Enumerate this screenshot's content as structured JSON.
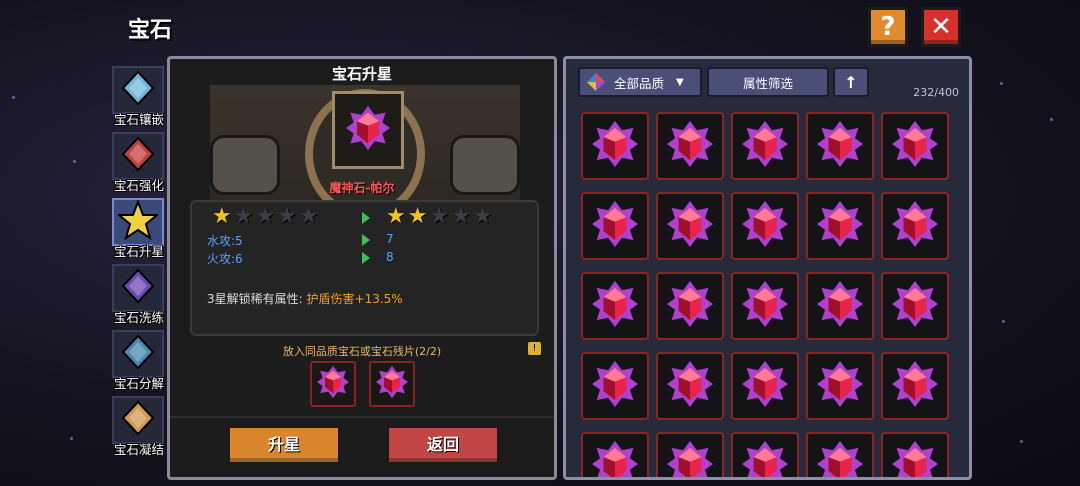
{
  "header": {
    "title": "宝石"
  },
  "buttons": {
    "help": "?",
    "close": "✕"
  },
  "sidebar": {
    "items": [
      {
        "label": "宝石镶嵌",
        "icon": "egg-gem-icon",
        "color": "#6fb7d8",
        "active": false
      },
      {
        "label": "宝石强化",
        "icon": "book-gem-icon",
        "color": "#c04040",
        "active": false
      },
      {
        "label": "宝石升星",
        "icon": "star-upgrade-icon",
        "color": "#f0d040",
        "active": true
      },
      {
        "label": "宝石洗练",
        "icon": "crystal-refine-icon",
        "color": "#6a4ab0",
        "active": false
      },
      {
        "label": "宝石分解",
        "icon": "decompose-icon",
        "color": "#4a8ab0",
        "active": false
      },
      {
        "label": "宝石凝结",
        "icon": "hammer-condense-icon",
        "color": "#d09a50",
        "active": false
      }
    ]
  },
  "left_panel": {
    "title": "宝石升星",
    "gem_name": "魔神石-帕尔",
    "stars_current": 1,
    "stars_next": 2,
    "stars_total": 5,
    "stats_current": [
      "水攻:5",
      "火攻:6"
    ],
    "stats_next": [
      "7",
      "8"
    ],
    "unlock_label": "3星解锁稀有属性:",
    "unlock_value": "护盾伤害+13.5%",
    "material_hint": "放入同品质宝石或宝石残片(2/2)",
    "mini_icon": "!",
    "upgrade_button": "升星",
    "back_button": "返回"
  },
  "right_panel": {
    "quality_filter": "全部品质",
    "attribute_filter": "属性筛选",
    "sort_arrow": "↑",
    "count": "232/400",
    "visible_cells": 25
  },
  "colors": {
    "gem_red": "#e8244a",
    "gem_purple": "#b040d0",
    "cell_border": "#8d2424"
  }
}
